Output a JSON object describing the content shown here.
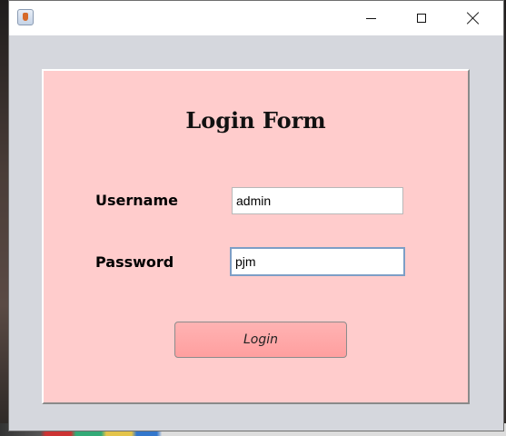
{
  "window": {
    "title": "",
    "icon": "java-cup-icon",
    "controls": {
      "minimize_icon": "minimize-icon",
      "maximize_icon": "maximize-icon",
      "close_icon": "close-icon"
    }
  },
  "form": {
    "title": "Login Form",
    "username_label": "Username",
    "username_value": "admin",
    "password_label": "Password",
    "password_value": "pjm",
    "login_button_label": "Login"
  },
  "colors": {
    "panel_background": "#ffcccc",
    "button_background": "#ff9f9f",
    "window_background": "#d5d7dd",
    "focused_input_border": "#7d9ec6"
  }
}
